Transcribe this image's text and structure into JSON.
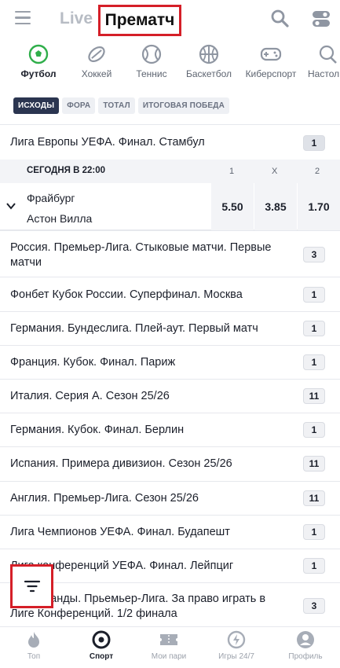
{
  "header": {
    "tab_live": "Live",
    "tab_prematch": "Прематч",
    "icons": [
      "menu-icon",
      "search-icon",
      "settings-toggle-icon"
    ]
  },
  "sports": [
    {
      "label": "Футбол",
      "icon": "football-icon",
      "active": true
    },
    {
      "label": "Хоккей",
      "icon": "hockey-puck-icon",
      "active": false
    },
    {
      "label": "Теннис",
      "icon": "tennis-ball-icon",
      "active": false
    },
    {
      "label": "Баскетбол",
      "icon": "basketball-icon",
      "active": false
    },
    {
      "label": "Киберспорт",
      "icon": "gamepad-icon",
      "active": false
    },
    {
      "label": "Настол",
      "icon": "table-tennis-icon",
      "active": false
    }
  ],
  "filters": [
    {
      "label": "ИСХОДЫ",
      "active": true
    },
    {
      "label": "ФОРА",
      "active": false
    },
    {
      "label": "ТОТАЛ",
      "active": false
    },
    {
      "label": "ИТОГОВАЯ ПОБЕДА",
      "active": false
    }
  ],
  "featured_league": {
    "title": "Лига Европы УЕФА. Финал. Стамбул",
    "count": "1"
  },
  "match": {
    "date": "СЕГОДНЯ В 22:00",
    "col_1": "1",
    "col_x": "X",
    "col_2": "2",
    "team1": "Фрайбург",
    "team2": "Астон Вилла",
    "odd_1": "5.50",
    "odd_x": "3.85",
    "odd_2": "1.70"
  },
  "leagues": [
    {
      "title": "Россия. Премьер-Лига. Стыковые матчи. Первые матчи",
      "count": "3"
    },
    {
      "title": "Фонбет Кубок России. Суперфинал. Москва",
      "count": "1"
    },
    {
      "title": "Германия. Бундеслига. Плей-аут. Первый матч",
      "count": "1"
    },
    {
      "title": "Франция. Кубок. Финал. Париж",
      "count": "1"
    },
    {
      "title": "Италия. Серия А. Сезон 25/26",
      "count": "11"
    },
    {
      "title": "Германия. Кубок. Финал. Берлин",
      "count": "1"
    },
    {
      "title": "Испания. Примера дивизион. Сезон 25/26",
      "count": "11"
    },
    {
      "title": "Англия. Премьер-Лига. Сезон 25/26",
      "count": "11"
    },
    {
      "title": "Лига Чемпионов УЕФА. Финал. Будапешт",
      "count": "1"
    },
    {
      "title": "Лига конференций УЕФА. Финал. Лейпциг",
      "count": "1"
    },
    {
      "title": "Нидерланды. Прьемьер-Лига. За право играть в Лиге Конференций. 1/2 финала",
      "count": "3"
    }
  ],
  "bottom_nav": [
    {
      "label": "Топ",
      "icon": "flame-icon",
      "active": false
    },
    {
      "label": "Спорт",
      "icon": "sport-target-icon",
      "active": true
    },
    {
      "label": "Мои пари",
      "icon": "ticket-icon",
      "active": false
    },
    {
      "label": "Игры 24/7",
      "icon": "lightning-icon",
      "active": false
    },
    {
      "label": "Профиль",
      "icon": "profile-icon",
      "active": false
    }
  ],
  "fab_icon": "filter-icon",
  "colors": {
    "accent_red": "#d51f28",
    "chip_active": "#2b3550"
  }
}
